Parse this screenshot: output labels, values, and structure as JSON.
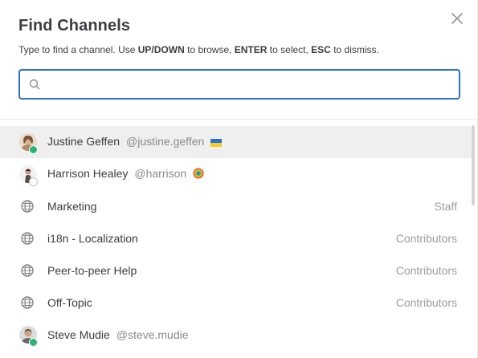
{
  "modal": {
    "title": "Find Channels",
    "hint": {
      "p1": "Type to find a channel. Use ",
      "k1": "UP/DOWN",
      "p2": " to browse, ",
      "k2": "ENTER",
      "p3": " to select, ",
      "k3": "ESC",
      "p4": " to dismiss."
    },
    "close_icon": "close-icon"
  },
  "search": {
    "value": "",
    "placeholder": "",
    "icon": "search-icon"
  },
  "results": [
    {
      "kind": "user",
      "name": "Justine Geffen",
      "handle": "@justine.geffen",
      "status": "online",
      "emoji": "ukraine-flag",
      "selected": true
    },
    {
      "kind": "user",
      "name": "Harrison Healey",
      "handle": "@harrison",
      "status": "offline",
      "emoji": "rainbow-circle",
      "selected": false
    },
    {
      "kind": "channel",
      "name": "Marketing",
      "team": "Staff",
      "icon": "globe-icon"
    },
    {
      "kind": "channel",
      "name": "i18n - Localization",
      "team": "Contributors",
      "icon": "globe-icon"
    },
    {
      "kind": "channel",
      "name": "Peer-to-peer Help",
      "team": "Contributors",
      "icon": "globe-icon"
    },
    {
      "kind": "channel",
      "name": "Off-Topic",
      "team": "Contributors",
      "icon": "globe-icon"
    },
    {
      "kind": "user",
      "name": "Steve Mudie",
      "handle": "@steve.mudie",
      "status": "online",
      "emoji": "",
      "selected": false
    }
  ],
  "colors": {
    "accent": "#2a72c9",
    "online": "#2bb673",
    "selected_row": "#efefef"
  }
}
